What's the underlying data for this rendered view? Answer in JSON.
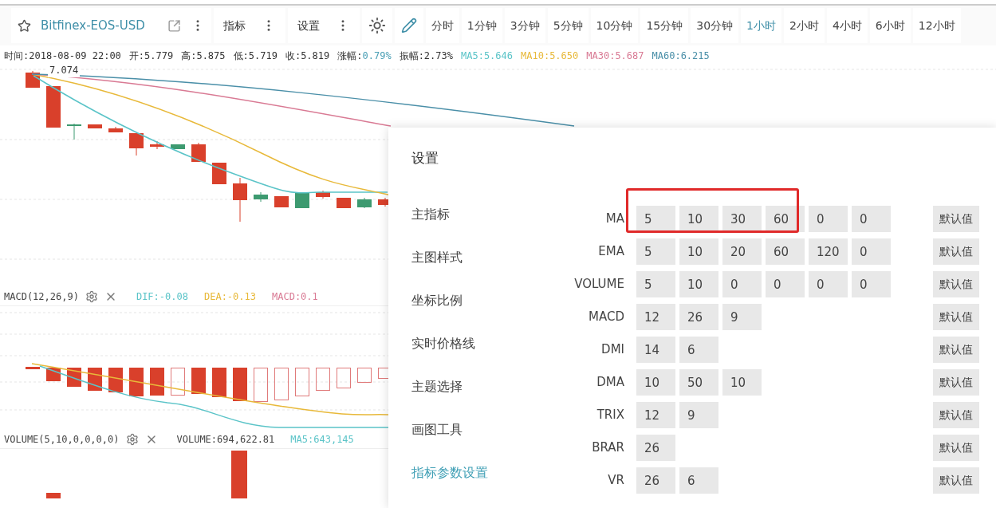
{
  "toolbar": {
    "symbol": "Bitfinex-EOS-USD",
    "buttons": [
      "指标",
      "设置"
    ]
  },
  "timeframes": [
    {
      "label": "分时",
      "selected": false
    },
    {
      "label": "1分钟",
      "selected": false
    },
    {
      "label": "3分钟",
      "selected": false
    },
    {
      "label": "5分钟",
      "selected": false
    },
    {
      "label": "10分钟",
      "selected": false
    },
    {
      "label": "15分钟",
      "selected": false
    },
    {
      "label": "30分钟",
      "selected": false
    },
    {
      "label": "1小时",
      "selected": true
    },
    {
      "label": "2小时",
      "selected": false
    },
    {
      "label": "4小时",
      "selected": false
    },
    {
      "label": "6小时",
      "selected": false
    },
    {
      "label": "12小时",
      "selected": false
    }
  ],
  "info": [
    {
      "label": "时间:",
      "value": "2018-08-09 22:00"
    },
    {
      "label": "开:",
      "value": "5.779"
    },
    {
      "label": "高:",
      "value": "5.875"
    },
    {
      "label": "低:",
      "value": "5.719"
    },
    {
      "label": "收:",
      "value": "5.819"
    },
    {
      "label": "涨幅:",
      "value": "0.79%",
      "color": "#4a9fb5"
    },
    {
      "label": "振幅:",
      "value": "2.73%"
    }
  ],
  "ma_legend": [
    {
      "text": "MA5:5.646",
      "color": "#5bc4c8"
    },
    {
      "text": "MA10:5.650",
      "color": "#e8b93a"
    },
    {
      "text": "MA30:5.687",
      "color": "#d97a94"
    },
    {
      "text": "MA60:6.215",
      "color": "#4a8fa8"
    }
  ],
  "price_label": "7.074",
  "macd": {
    "title": "MACD(12,26,9)",
    "legend": [
      {
        "text": "DIF:-0.08",
        "color": "#5bc4c8"
      },
      {
        "text": "DEA:-0.13",
        "color": "#e8b93a"
      },
      {
        "text": "MACD:0.1",
        "color": "#d97a94"
      }
    ]
  },
  "volume": {
    "title": "VOLUME(5,10,0,0,0,0)",
    "legend": [
      {
        "text": "VOLUME:694,622.81",
        "color": "#444444"
      },
      {
        "text": "MA5:643,145",
        "color": "#5bc4c8"
      }
    ]
  },
  "settings": {
    "title": "设置",
    "menu": [
      {
        "label": "主指标",
        "selected": false
      },
      {
        "label": "主图样式",
        "selected": false
      },
      {
        "label": "坐标比例",
        "selected": false
      },
      {
        "label": "实时价格线",
        "selected": false
      },
      {
        "label": "主题选择",
        "selected": false
      },
      {
        "label": "画图工具",
        "selected": false
      },
      {
        "label": "指标参数设置",
        "selected": true
      }
    ],
    "params": [
      {
        "name": "MA",
        "values": [
          "5",
          "10",
          "30",
          "60",
          "0",
          "0"
        ],
        "default_label": "默认值"
      },
      {
        "name": "EMA",
        "values": [
          "5",
          "10",
          "20",
          "60",
          "120",
          "0"
        ],
        "default_label": "默认值"
      },
      {
        "name": "VOLUME",
        "values": [
          "5",
          "10",
          "0",
          "0",
          "0",
          "0"
        ],
        "default_label": "默认值"
      },
      {
        "name": "MACD",
        "values": [
          "12",
          "26",
          "9"
        ],
        "default_label": "默认值"
      },
      {
        "name": "DMI",
        "values": [
          "14",
          "6"
        ],
        "default_label": "默认值"
      },
      {
        "name": "DMA",
        "values": [
          "10",
          "50",
          "10"
        ],
        "default_label": "默认值"
      },
      {
        "name": "TRIX",
        "values": [
          "12",
          "9"
        ],
        "default_label": "默认值"
      },
      {
        "name": "BRAR",
        "values": [
          "26"
        ],
        "default_label": "默认值"
      },
      {
        "name": "VR",
        "values": [
          "26",
          "6"
        ],
        "default_label": "默认值"
      }
    ]
  }
}
